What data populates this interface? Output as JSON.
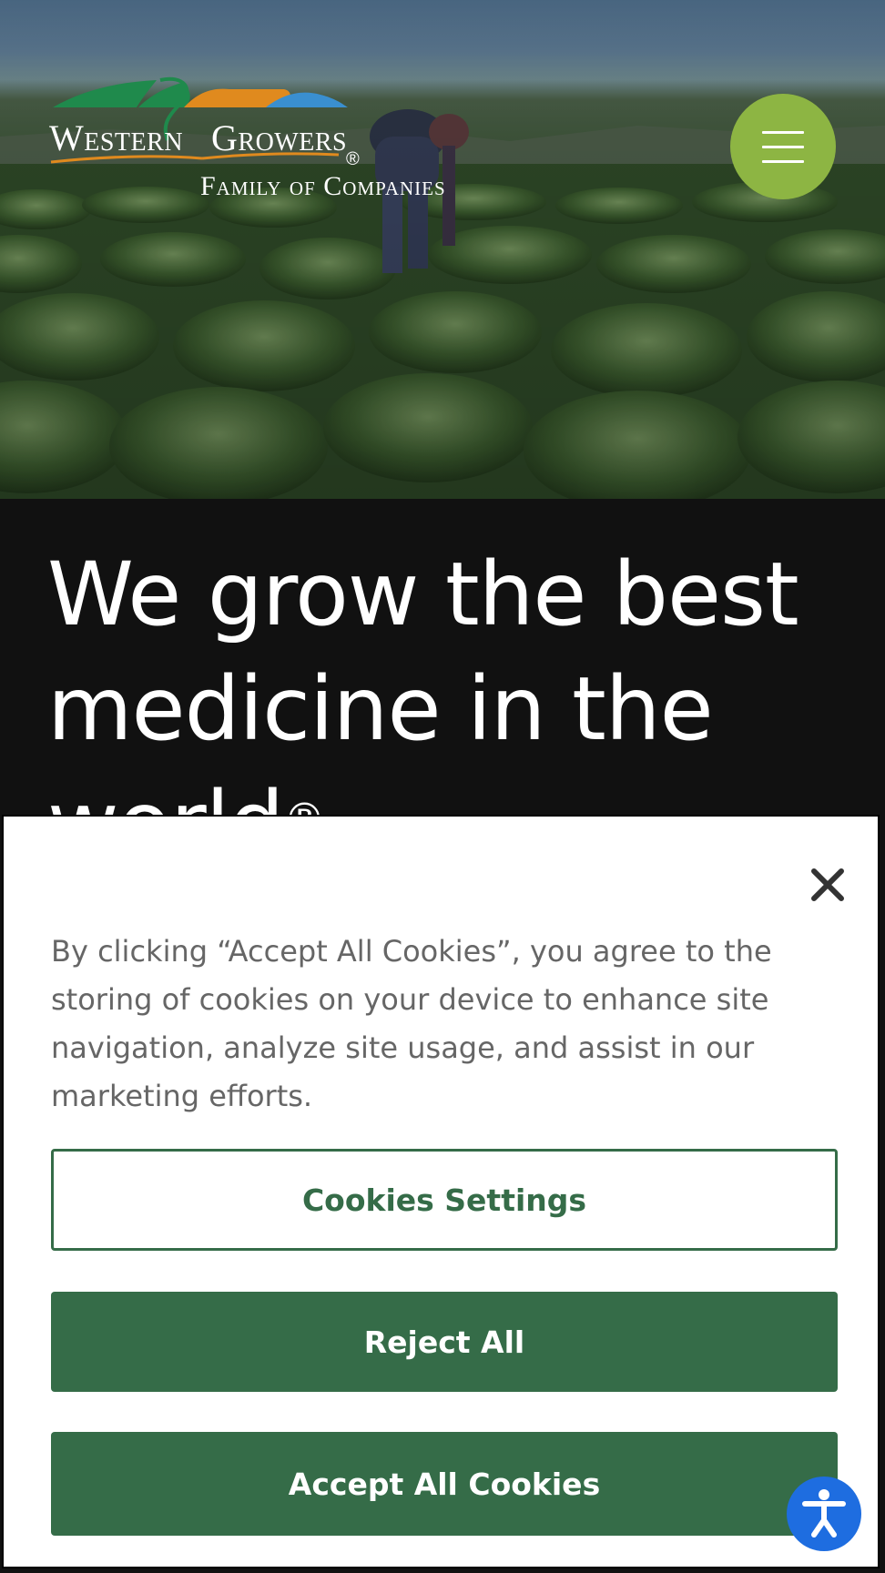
{
  "header": {
    "logo": {
      "word1": "Western",
      "word2": "Growers",
      "registered": "®",
      "subtitle": "Family of Companies"
    },
    "menu_icon": "hamburger-menu-icon"
  },
  "hero": {
    "headline": "We grow the best medicine in the world",
    "headline_mark": "®"
  },
  "cookie_banner": {
    "close_icon": "close-icon",
    "message": "By clicking “Accept All Cookies”, you agree to the storing of cookies on your device to enhance site navigation, analyze site usage, and assist in our marketing efforts.",
    "settings_label": "Cookies Settings",
    "reject_label": "Reject All",
    "accept_label": "Accept All Cookies"
  },
  "accessibility_icon": "accessibility-icon",
  "colors": {
    "brand_green": "#356c48",
    "menu_green": "#8db543",
    "accessibility_blue": "#1e6de0",
    "logo_green": "#1f8a4c",
    "logo_orange": "#e08a1e",
    "logo_blue": "#3a8fd0"
  }
}
